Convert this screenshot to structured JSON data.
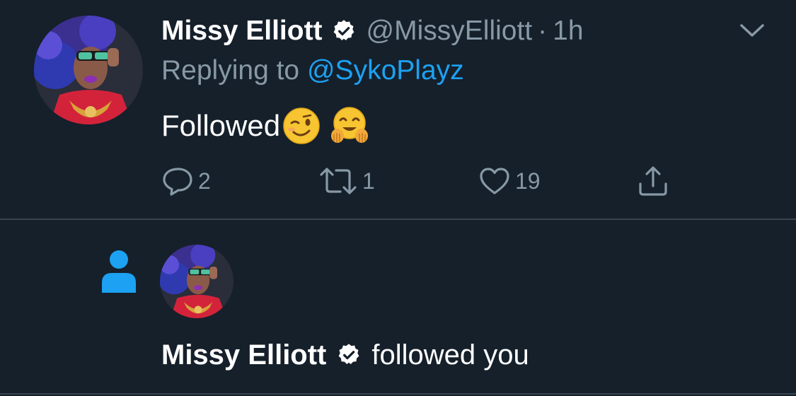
{
  "tweet": {
    "author": {
      "display_name": "Missy Elliott",
      "handle": "@MissyElliott",
      "verified": true,
      "avatar": "profile-photo"
    },
    "separator": "·",
    "time": "1h",
    "menu_icon": "chevron-down-icon",
    "replying_prefix": "Replying to",
    "replying_to": "@SykoPlayz",
    "text": "Followed",
    "emojis": [
      "winking-face",
      "hugging-face"
    ],
    "actions": {
      "reply": {
        "icon": "reply-icon",
        "count": "2"
      },
      "retweet": {
        "icon": "retweet-icon",
        "count": "1"
      },
      "like": {
        "icon": "heart-icon",
        "count": "19"
      },
      "share": {
        "icon": "share-icon"
      }
    }
  },
  "notification": {
    "type_icon": "person-icon",
    "user": {
      "display_name": "Missy Elliott",
      "verified": true,
      "avatar": "profile-photo"
    },
    "action_text": "followed you"
  },
  "colors": {
    "background": "#15202b",
    "primary_text": "#ffffff",
    "secondary_text": "#8899a6",
    "accent": "#1da1f2",
    "divider": "#38444d"
  }
}
